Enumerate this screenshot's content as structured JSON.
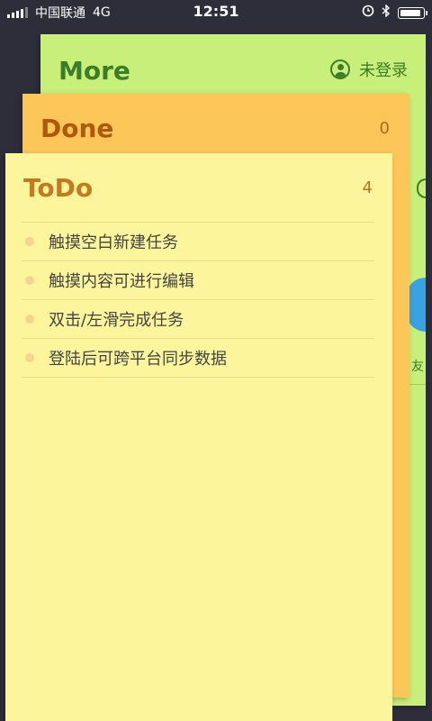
{
  "status_bar": {
    "carrier": "中国联通",
    "network": "4G",
    "time": "12:51"
  },
  "cards": {
    "more": {
      "title": "More",
      "user_label": "未登录",
      "peek_text": "友"
    },
    "done": {
      "title": "Done",
      "count": "0"
    },
    "todo": {
      "title": "ToDo",
      "count": "4",
      "items": [
        "触摸空白新建任务",
        "触摸内容可进行编辑",
        "双击/左滑完成任务",
        "登陆后可跨平台同步数据"
      ]
    }
  },
  "colors": {
    "background": "#2e2e3a",
    "more_card": "#c8ef7a",
    "done_card": "#fcc758",
    "todo_card": "#fcf59b",
    "more_accent": "#3c7d28",
    "done_accent": "#b0580e",
    "todo_accent": "#c67a1f"
  },
  "icons": [
    "signal-icon",
    "alarm-icon",
    "bluetooth-icon",
    "battery-icon",
    "user-icon"
  ]
}
